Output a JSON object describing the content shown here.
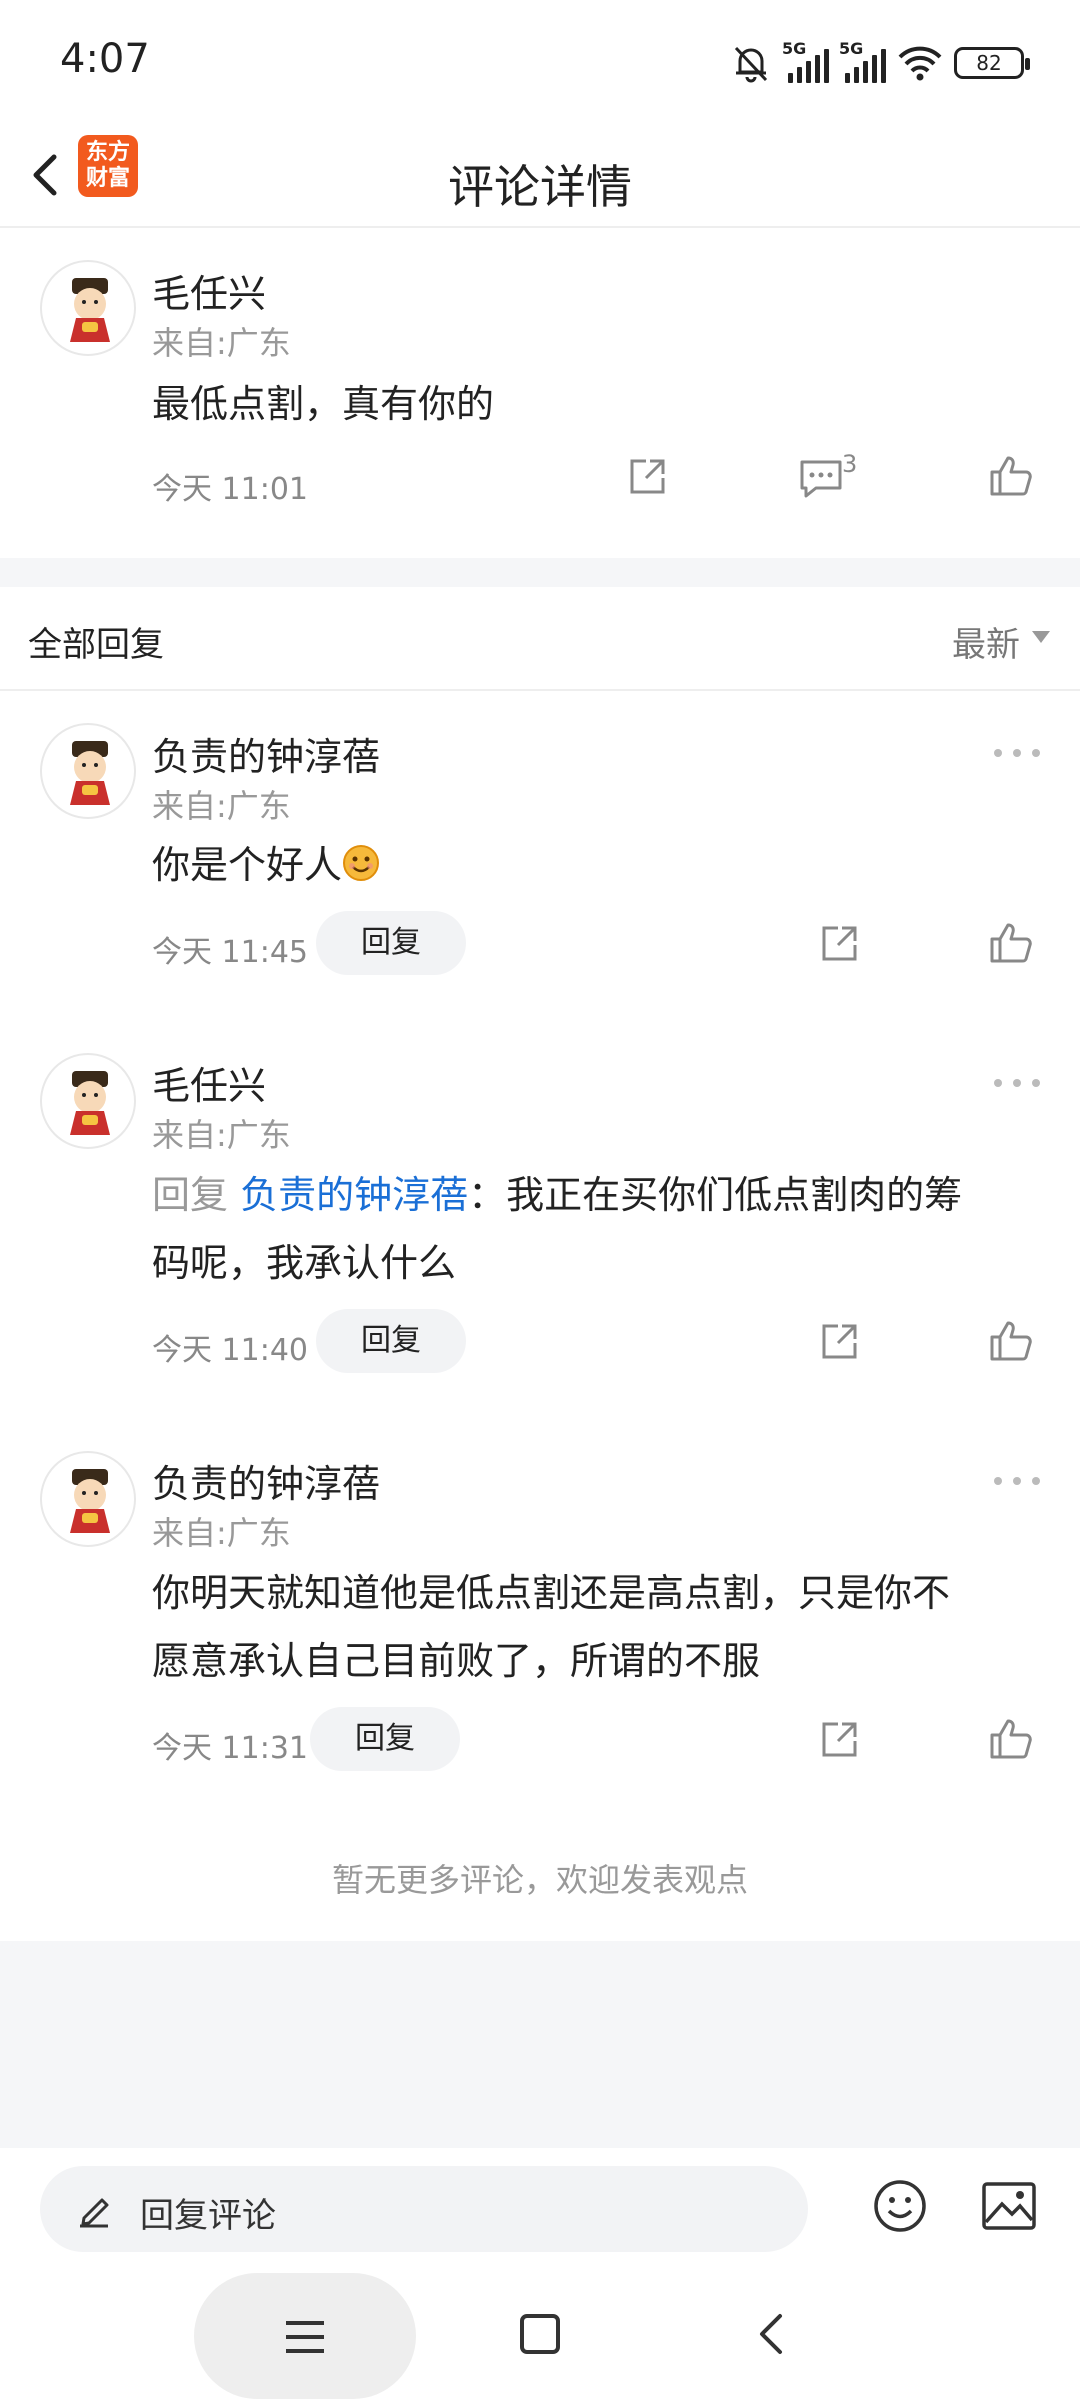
{
  "status": {
    "time": "4:07",
    "sig1": "5G",
    "sig2": "5G",
    "battery": "82"
  },
  "header": {
    "title": "评论详情",
    "logo_line1": "东方",
    "logo_line2": "财富"
  },
  "main_comment": {
    "user": "毛任兴",
    "location": "来自:广东",
    "text": "最低点割，真有你的",
    "time": "今天 11:01",
    "reply_count": "3"
  },
  "replies_header": {
    "label": "全部回复",
    "sort": "最新"
  },
  "replies": [
    {
      "user": "负责的钟淳蓓",
      "location": "来自:广东",
      "text": "你是个好人",
      "time": "今天 11:45",
      "reply_label": "回复"
    },
    {
      "user": "毛任兴",
      "location": "来自:广东",
      "prefix": "回复 ",
      "mention": "负责的钟淳蓓",
      "text_line1": "：我正在买你们低点割肉的筹",
      "text_line2": "码呢，我承认什么",
      "time": "今天 11:40",
      "reply_label": "回复"
    },
    {
      "user": "负责的钟淳蓓",
      "location": "来自:广东",
      "text_line1": "你明天就知道他是低点割还是高点割，只是你不",
      "text_line2": "愿意承认自己目前败了，所谓的不服",
      "time": "今天 11:31",
      "reply_label": "回复"
    }
  ],
  "no_more": "暂无更多评论，欢迎发表观点",
  "input": {
    "placeholder": "回复评论"
  }
}
